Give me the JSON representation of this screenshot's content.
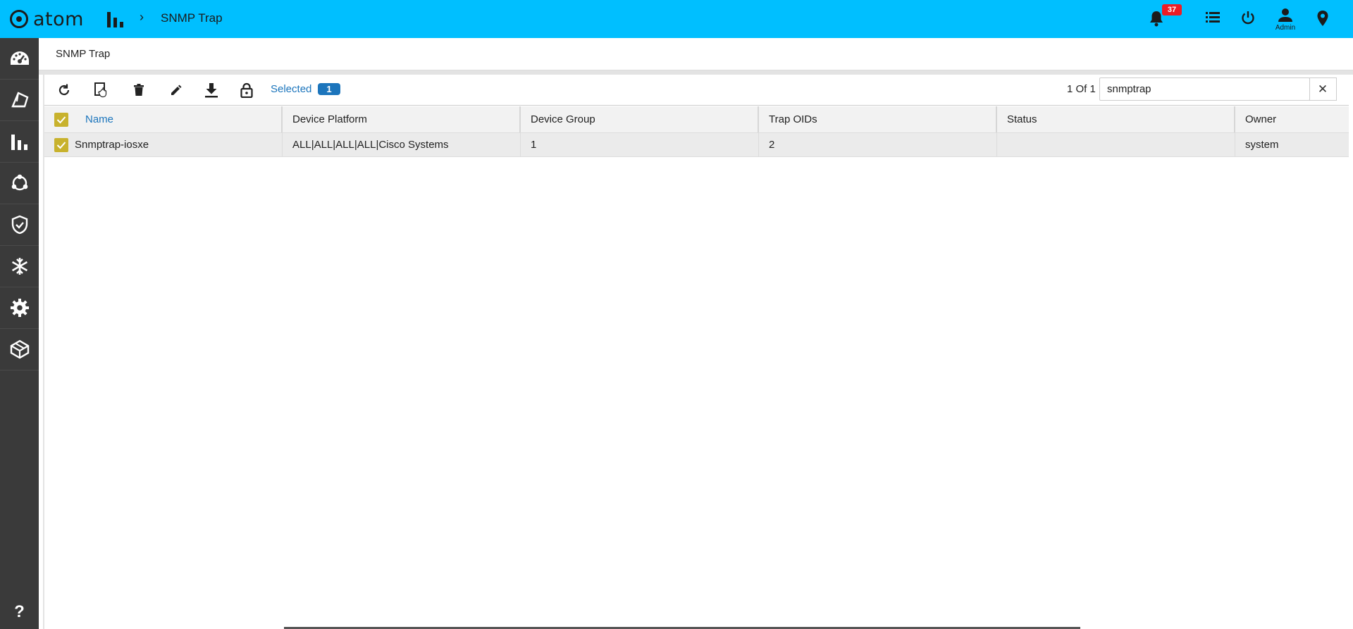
{
  "app": {
    "name": "atom"
  },
  "topbar": {
    "breadcrumb": "SNMP Trap",
    "notifications_count": "37",
    "user_label": "Admin"
  },
  "page": {
    "title": "SNMP Trap"
  },
  "toolbar": {
    "selected_label": "Selected",
    "selected_count": "1",
    "pagination": "1 Of 1",
    "search_value": "snmptrap",
    "clear_symbol": "✕"
  },
  "table": {
    "columns": [
      "Name",
      "Device Platform",
      "Device Group",
      "Trap OIDs",
      "Status",
      "Owner"
    ],
    "rows": [
      {
        "name": "Snmptrap-iosxe",
        "platform": "ALL|ALL|ALL|ALL|Cisco Systems",
        "group": "1",
        "oids": "2",
        "status": "",
        "owner": "system",
        "checked": true
      }
    ]
  },
  "sidebar": {
    "items": [
      "dashboard-icon",
      "topology-icon",
      "analytics-icon",
      "workflow-icon",
      "compliance-icon",
      "freeze-icon",
      "settings-icon",
      "packages-icon"
    ],
    "help": "?"
  },
  "colors": {
    "topbar": "#00bfff",
    "sidebar": "#3a3a3a",
    "accent": "#1c75bc",
    "checkbox": "#c8b22d",
    "badge": "#ee1c25"
  }
}
